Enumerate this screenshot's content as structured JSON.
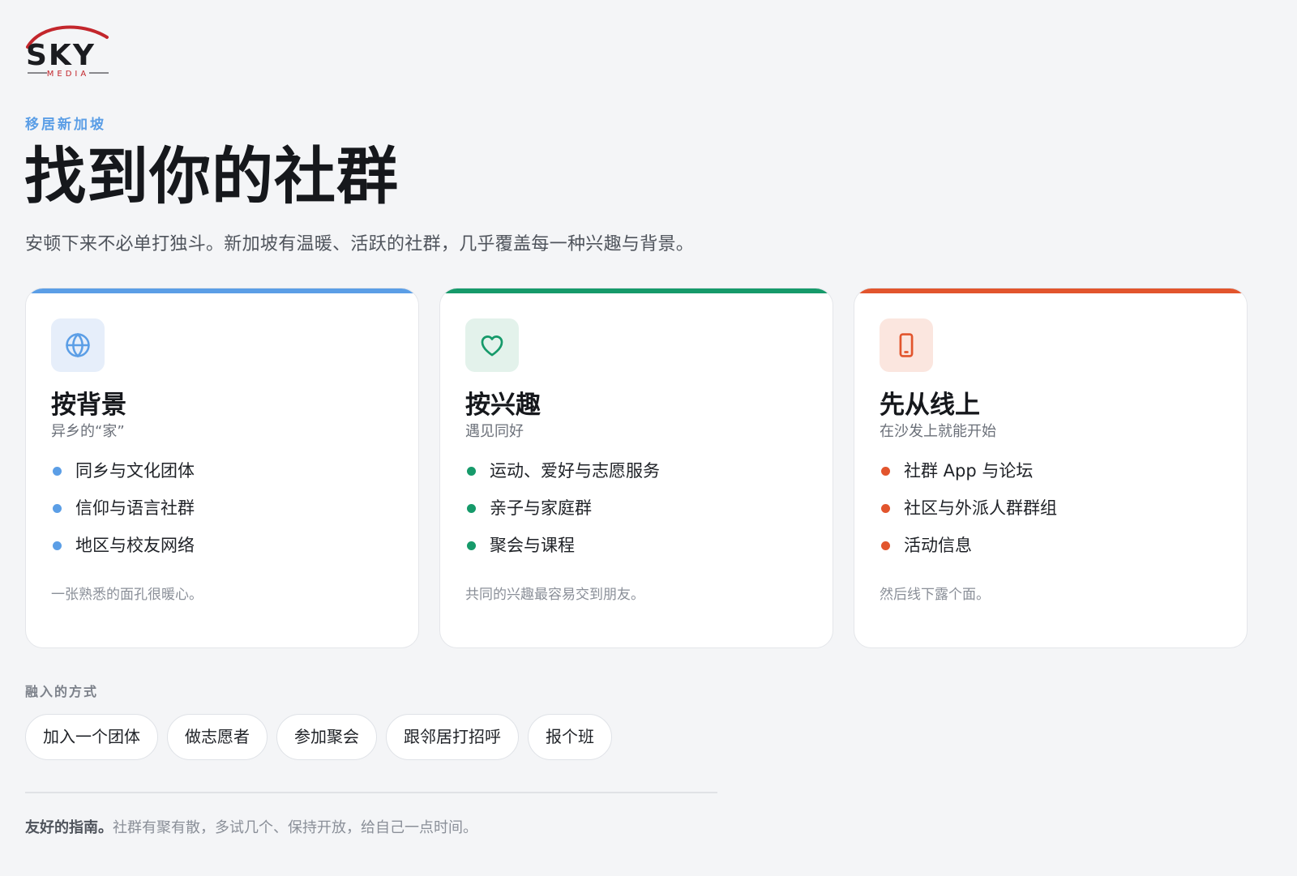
{
  "brand": {
    "logo_text": "SKY",
    "logo_subtext": "MEDIA",
    "logo_swoosh_color": "#c3262c"
  },
  "eyebrow": "移居新加坡",
  "headline": "找到你的社群",
  "lead": "安顿下来不必单打独斗。新加坡有温暖、活跃的社群，几乎覆盖每一种兴趣与背景。",
  "cards": [
    {
      "icon": "globe-icon",
      "accent": "#5b9ee6",
      "tint": "#e6eefa",
      "title": "按背景",
      "subtitle": "异乡的“家”",
      "items": [
        "同乡与文化团体",
        "信仰与语言社群",
        "地区与校友网络"
      ],
      "note": "一张熟悉的面孔很暖心。"
    },
    {
      "icon": "heart-icon",
      "accent": "#169a6a",
      "tint": "#e3f2eb",
      "title": "按兴趣",
      "subtitle": "遇见同好",
      "items": [
        "运动、爱好与志愿服务",
        "亲子与家庭群",
        "聚会与课程"
      ],
      "note": "共同的兴趣最容易交到朋友。"
    },
    {
      "icon": "phone-icon",
      "accent": "#e2552d",
      "tint": "#fbe6df",
      "title": "先从线上",
      "subtitle": "在沙发上就能开始",
      "items": [
        "社群 App 与论坛",
        "社区与外派人群群组",
        "活动信息"
      ],
      "note": "然后线下露个面。"
    }
  ],
  "ways": {
    "label": "融入的方式",
    "chips": [
      "加入一个团体",
      "做志愿者",
      "参加聚会",
      "跟邻居打招呼",
      "报个班"
    ]
  },
  "footer": {
    "lead": "友好的指南。",
    "text": "社群有聚有散，多试几个、保持开放，给自己一点时间。"
  }
}
